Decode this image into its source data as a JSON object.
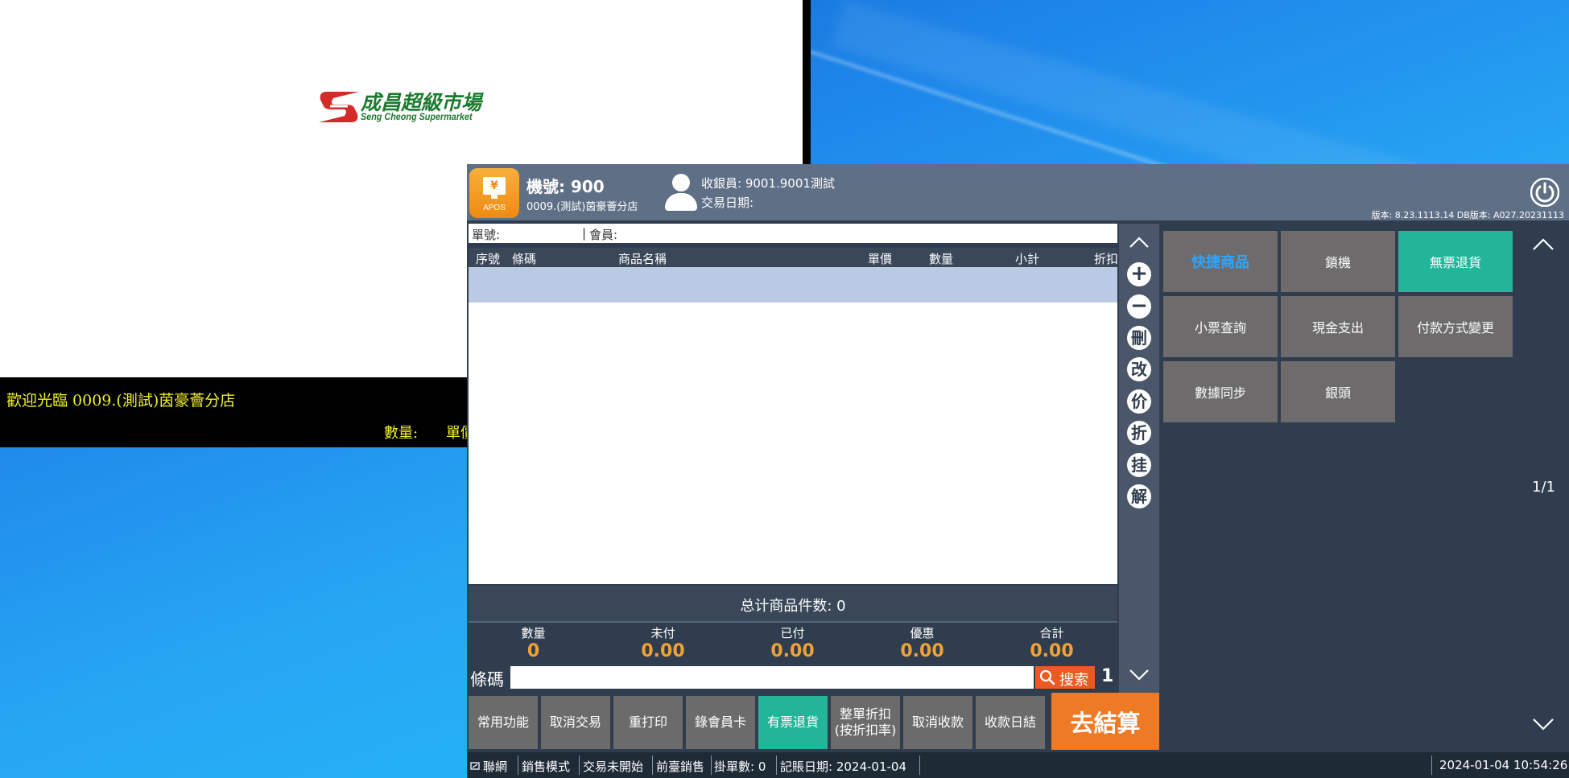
{
  "customer_display": {
    "logo_cn": "成昌超級市場",
    "logo_en": "Seng Cheong Supermarket",
    "welcome": "歡迎光臨 0009.(測試)茵豪薈分店",
    "qty_label": "數量:",
    "unit_label": "單價"
  },
  "header": {
    "app_label": "APOS",
    "machine": "機號: 900",
    "store": "0009.(測試)茵豪薈分店",
    "cashier": "收銀員: 9001.9001測試",
    "trade_date": "交易日期:",
    "version": "版本: 8.23.1113.14 DB版本: A027.20231113"
  },
  "order": {
    "order_no_label": "單號:",
    "separator": "|",
    "member_label": "會員:",
    "columns": [
      "序號",
      "條碼",
      "商品名稱",
      "單價",
      "數量",
      "小計",
      "折扣"
    ],
    "total_items": "总计商品件数: 0",
    "summary": [
      {
        "label": "數量",
        "value": "0"
      },
      {
        "label": "未付",
        "value": "0.00"
      },
      {
        "label": "已付",
        "value": "0.00"
      },
      {
        "label": "優惠",
        "value": "0.00"
      },
      {
        "label": "合計",
        "value": "0.00"
      }
    ],
    "barcode_label": "條碼",
    "barcode_value": "",
    "search_label": "搜索",
    "count": "1"
  },
  "tools": {
    "add": "+",
    "minus": "−",
    "delete": "刪",
    "modify": "改",
    "price": "价",
    "discount": "折",
    "hold": "挂",
    "release": "解"
  },
  "functions": [
    "常用功能",
    "取消交易",
    "重打印",
    "錄會員卡",
    "有票退貨",
    "整單折扣(按折扣率)",
    "取消收款",
    "收款日結"
  ],
  "checkout": "去結算",
  "quick": {
    "buttons": [
      "快捷商品",
      "鎖機",
      "無票退貨",
      "小票查詢",
      "現金支出",
      "付款方式變更",
      "數據同步",
      "銀頭"
    ],
    "page": "1/1"
  },
  "status": {
    "network": "聯網",
    "mode": "銷售模式",
    "trade_state": "交易未開始",
    "sale_type": "前臺銷售",
    "hold_count": "掛單數: 0",
    "book_date": "記賬日期: 2024-01-04",
    "clock": "2024-01-04 10:54:26"
  },
  "colors": {
    "accent_orange": "#ef7a25",
    "teal": "#22b59a",
    "header_bg": "#5f6f86",
    "panel_bg": "#2f3d4e"
  }
}
